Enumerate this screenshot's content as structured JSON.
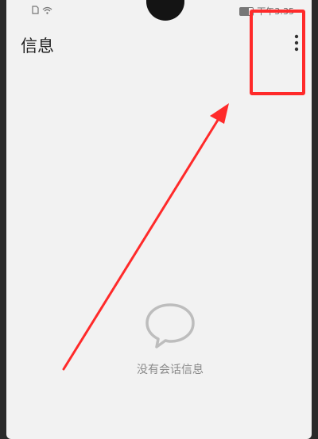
{
  "header": {
    "title": "信息"
  },
  "status_bar": {
    "time": "下午3:35"
  },
  "empty_state": {
    "message": "没有会话信息",
    "icon": "chat-bubble-icon"
  },
  "menu": {
    "icon": "more-vertical-icon"
  },
  "annotation": {
    "color": "#ff2a2a"
  }
}
